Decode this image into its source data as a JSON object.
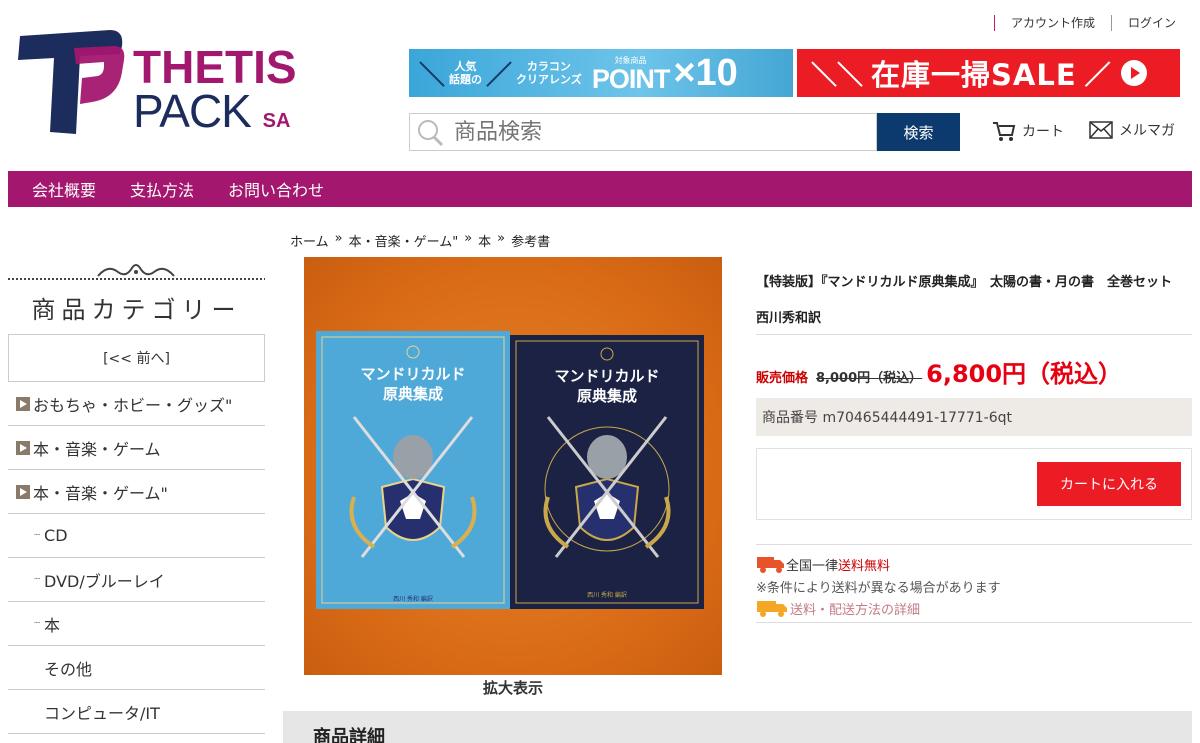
{
  "header": {
    "account_create": "アカウント作成",
    "login": "ログイン",
    "logo_line1": "THETIS",
    "logo_line2": "PACK",
    "logo_sa": "SA",
    "banner1": {
      "line1a": "人気",
      "line1b": "話題の",
      "line2a": "カラコン",
      "line2b": "クリアレンズ",
      "tag": "対象商品",
      "point": "POINT",
      "times": "×10"
    },
    "banner2": {
      "text": "在庫一掃SALE"
    },
    "search_placeholder": "商品検索",
    "search_button": "検索",
    "cart": "カート",
    "mailmag": "メルマガ"
  },
  "nav": {
    "items": [
      "会社概要",
      "支払方法",
      "お問い合わせ"
    ]
  },
  "breadcrumb": [
    "ホーム",
    "»",
    "本・音楽・ゲーム\"",
    "»",
    "本",
    "»",
    "参考書"
  ],
  "sidebar": {
    "title": "商品カテゴリー",
    "prev": "[<< 前へ]",
    "items": [
      {
        "label": "おもちゃ・ホビー・グッズ\""
      },
      {
        "label": "本・音楽・ゲーム"
      },
      {
        "label": "本・音楽・ゲーム\""
      }
    ],
    "sub_items": [
      {
        "label": "CD"
      },
      {
        "label": "DVD/ブルーレイ"
      },
      {
        "label": "本"
      }
    ],
    "sub2_items": [
      {
        "label": "その他"
      },
      {
        "label": "コンピュータ/IT"
      }
    ]
  },
  "product": {
    "title": "【特装版】『マンドリカルド原典集成』　太陽の書・月の書　全巻セット　西川秀和訳",
    "price_label": "販売価格",
    "price_old": "8,000円（税込）",
    "price_new": "6,800円（税込）",
    "sku": "商品番号 m70465444491-17771-6qt",
    "add_to_cart": "カートに入れる",
    "zoom": "拡大表示",
    "book_title_line1": "マンドリカルド",
    "book_title_line2": "原典集成",
    "book_author": "西川 秀和 編訳"
  },
  "shipping": {
    "prefix": "全国一律",
    "free": "送料無料",
    "note": "※条件により送料が異なる場合があります",
    "details_link": "送料・配送方法の詳細"
  },
  "detail_heading": "商品詳細",
  "colors": {
    "brand_magenta": "#a3176f",
    "brand_navy": "#1c2c5c",
    "sale_red": "#ec1c24",
    "search_navy": "#0d3a6e"
  }
}
